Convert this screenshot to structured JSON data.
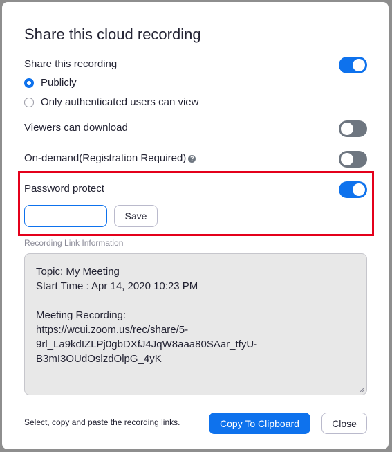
{
  "dialog": {
    "title": "Share this cloud recording",
    "share_recording": {
      "label": "Share this recording",
      "enabled": true
    },
    "visibility_options": [
      {
        "label": "Publicly",
        "selected": true
      },
      {
        "label": "Only authenticated users can view",
        "selected": false
      }
    ],
    "viewers_download": {
      "label": "Viewers can download",
      "enabled": false
    },
    "on_demand": {
      "label": "On-demand(Registration Required)",
      "help_icon": "question-circle",
      "enabled": false
    },
    "password_protect": {
      "label": "Password protect",
      "enabled": true,
      "password_value": "",
      "save_label": "Save"
    },
    "link_info": {
      "section_label": "Recording Link Information",
      "lines": [
        "Topic: My Meeting",
        "Start Time : Apr 14, 2020 10:23 PM",
        "",
        "Meeting Recording:",
        "https://wcui.zoom.us/rec/share/5-",
        "9rl_La9kdIZLPj0gbDXfJ4JqW8aaa80SAar_tfyU-",
        "B3mI3OUdOslzdOlpG_4yK"
      ]
    },
    "footer": {
      "hint": "Select, copy and paste the recording links.",
      "copy_label": "Copy To Clipboard",
      "close_label": "Close"
    }
  },
  "colors": {
    "accent": "#0e72ed",
    "toggle_off": "#6e7680",
    "highlight": "#e4001b"
  }
}
